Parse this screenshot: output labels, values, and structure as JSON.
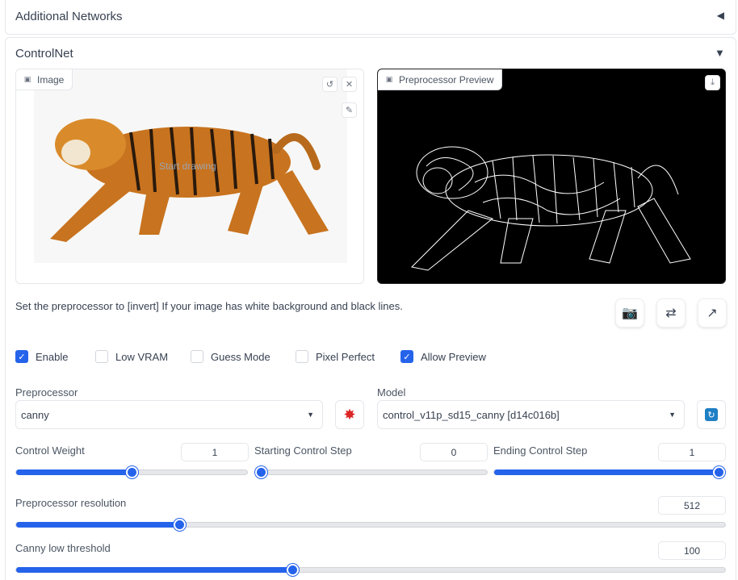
{
  "additional_networks": {
    "title": "Additional Networks",
    "arrow": "◀"
  },
  "controlnet": {
    "title": "ControlNet",
    "arrow": "▼",
    "image_panel": {
      "label": "Image",
      "placeholder": "Start drawing"
    },
    "preview_panel": {
      "label": "Preprocessor Preview"
    },
    "hint": "Set the preprocessor to [invert] If your image has white background and black lines.",
    "checkboxes": [
      {
        "label": "Enable",
        "checked": true
      },
      {
        "label": "Low VRAM",
        "checked": false
      },
      {
        "label": "Guess Mode",
        "checked": false
      },
      {
        "label": "Pixel Perfect",
        "checked": false
      },
      {
        "label": "Allow Preview",
        "checked": true
      }
    ],
    "preprocessor": {
      "label": "Preprocessor",
      "value": "canny"
    },
    "model": {
      "label": "Model",
      "value": "control_v11p_sd15_canny [d14c016b]"
    },
    "control_weight": {
      "label": "Control Weight",
      "value": "1",
      "fraction": 0.5
    },
    "starting_step": {
      "label": "Starting Control Step",
      "value": "0",
      "fraction": 0.0
    },
    "ending_step": {
      "label": "Ending Control Step",
      "value": "1",
      "fraction": 1.0
    },
    "preprocessor_resolution": {
      "label": "Preprocessor resolution",
      "value": "512",
      "fraction": 0.23
    },
    "canny_low": {
      "label": "Canny low threshold",
      "value": "100",
      "fraction": 0.39
    }
  },
  "colors": {
    "accent": "#2563eb",
    "border": "#e5e7eb",
    "text": "#374151"
  }
}
